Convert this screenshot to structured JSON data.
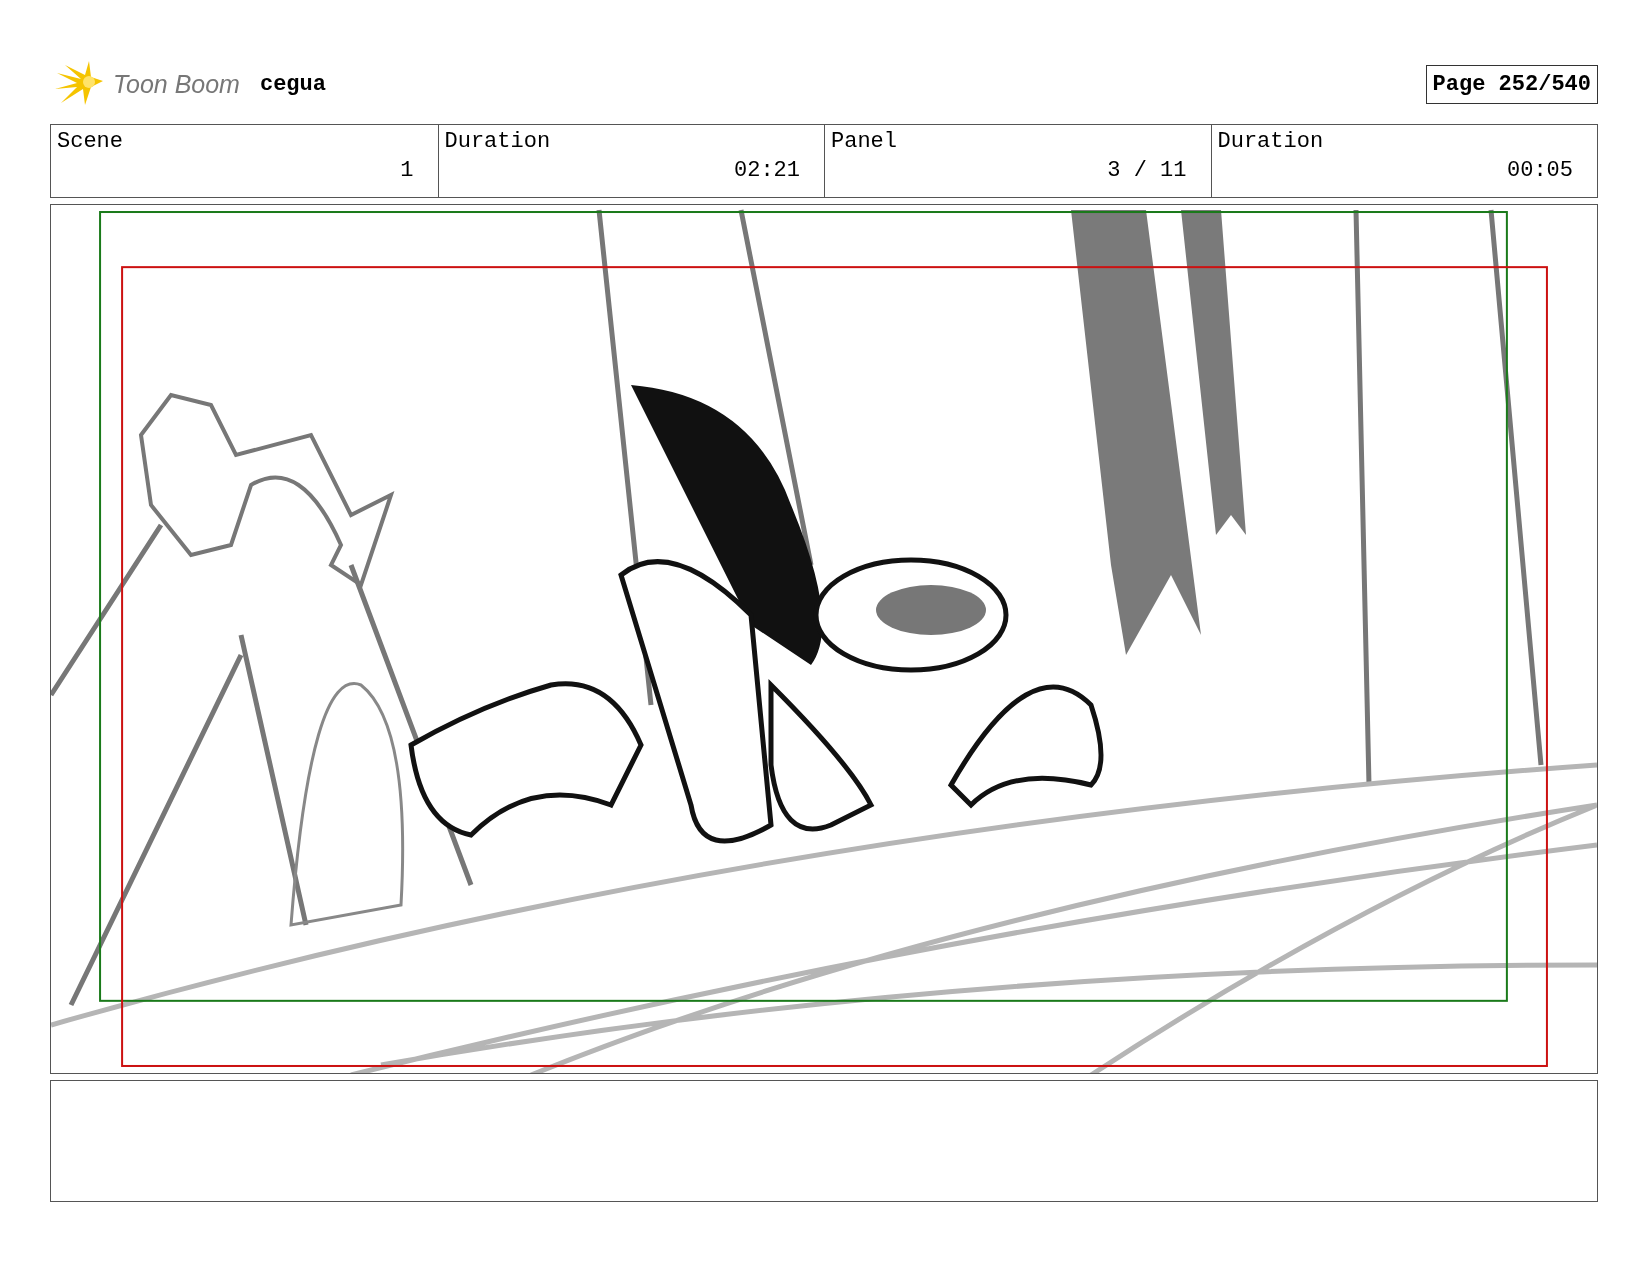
{
  "header": {
    "logo": "Toon Boom",
    "project": "cegua",
    "page": "Page 252/540"
  },
  "fields": [
    {
      "label": "Scene",
      "value": "1"
    },
    {
      "label": "Duration",
      "value": "02:21"
    },
    {
      "label": "Panel",
      "value": "3 / 11"
    },
    {
      "label": "Duration",
      "value": "00:05"
    }
  ]
}
